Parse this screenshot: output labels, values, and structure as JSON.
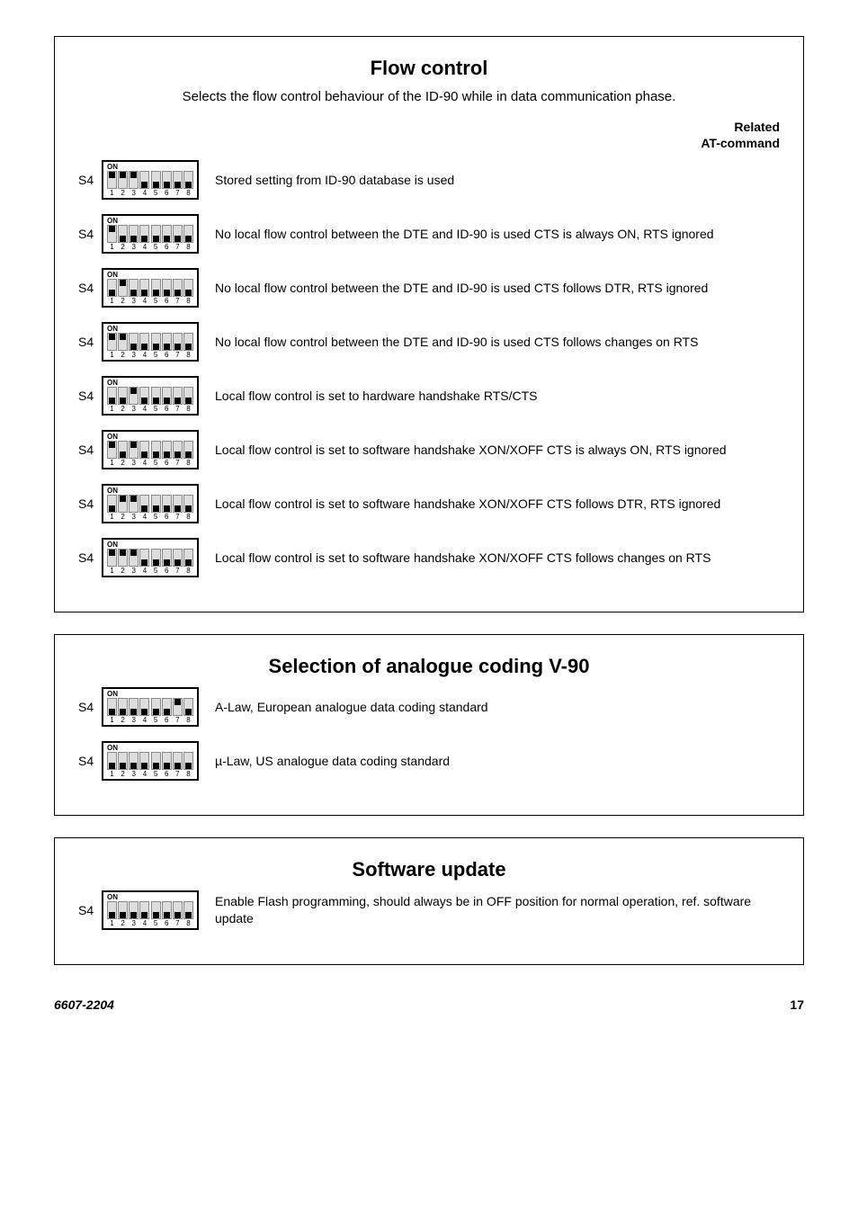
{
  "panels": {
    "flow": {
      "title": "Flow control",
      "intro": "Selects the flow control behaviour of the ID-90 while in data communication phase.",
      "related": "Related\nAT-command"
    },
    "v90": {
      "title": "Selection of analogue coding V-90"
    },
    "sw": {
      "title": "Software update"
    }
  },
  "switch_label": "S4",
  "dip": {
    "on_label": "ON",
    "numbers": [
      "1",
      "2",
      "3",
      "4",
      "5",
      "6",
      "7",
      "8"
    ]
  },
  "flow_rows": [
    {
      "switches": [
        1,
        1,
        1,
        0,
        0,
        0,
        0,
        0
      ],
      "desc": "Stored setting from ID-90 database is used"
    },
    {
      "switches": [
        1,
        0,
        0,
        0,
        0,
        0,
        0,
        0
      ],
      "desc": "No local flow control between the DTE and ID-90 is used CTS is always ON, RTS ignored"
    },
    {
      "switches": [
        0,
        1,
        0,
        0,
        0,
        0,
        0,
        0
      ],
      "desc": "No local flow control between the DTE and ID-90 is used CTS follows DTR, RTS ignored"
    },
    {
      "switches": [
        1,
        1,
        0,
        0,
        0,
        0,
        0,
        0
      ],
      "desc": "No local flow control between the DTE and ID-90 is used CTS follows changes on RTS"
    },
    {
      "switches": [
        0,
        0,
        1,
        0,
        0,
        0,
        0,
        0
      ],
      "desc": "Local flow control is set to hardware handshake RTS/CTS"
    },
    {
      "switches": [
        1,
        0,
        1,
        0,
        0,
        0,
        0,
        0
      ],
      "desc": "Local flow control is set to software handshake XON/XOFF CTS is always ON, RTS ignored"
    },
    {
      "switches": [
        0,
        1,
        1,
        0,
        0,
        0,
        0,
        0
      ],
      "desc": "Local flow control is set to software handshake XON/XOFF CTS follows DTR, RTS ignored"
    },
    {
      "switches": [
        1,
        1,
        1,
        0,
        0,
        0,
        0,
        0
      ],
      "desc": "Local flow control is set to software handshake XON/XOFF CTS follows changes on RTS"
    }
  ],
  "v90_rows": [
    {
      "switches": [
        0,
        0,
        0,
        0,
        0,
        0,
        1,
        0
      ],
      "desc": "A-Law, European analogue data coding standard"
    },
    {
      "switches": [
        0,
        0,
        0,
        0,
        0,
        0,
        0,
        0
      ],
      "desc": "µ-Law, US analogue data coding standard"
    }
  ],
  "sw_rows": [
    {
      "switches": [
        0,
        0,
        0,
        0,
        0,
        0,
        0,
        0
      ],
      "desc": "Enable Flash programming, should always be in OFF position for normal operation, ref. software update"
    }
  ],
  "footer": {
    "doc": "6607-2204",
    "page": "17"
  }
}
